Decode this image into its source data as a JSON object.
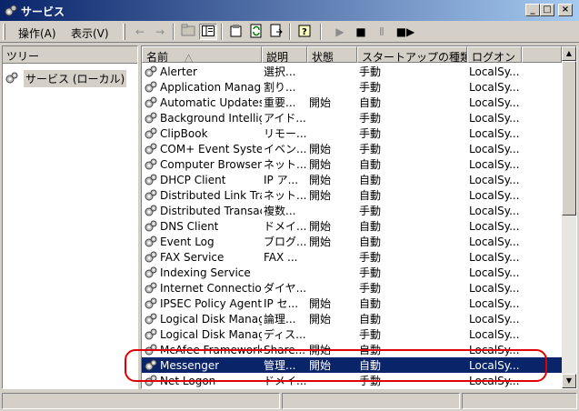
{
  "window": {
    "title": "サービス",
    "icon": "gear-icon",
    "minimize_label": "_",
    "maximize_label": "□",
    "close_label": "×"
  },
  "menu": {
    "action_label": "操作(A)",
    "view_label": "表示(V)"
  },
  "toolbar": {
    "back": "←",
    "forward": "→",
    "play": "▶",
    "stop": "■",
    "pause": "Ⅱ",
    "restart": "■▶"
  },
  "tree": {
    "header": "ツリー",
    "root_label": "サービス (ローカル)"
  },
  "list": {
    "columns": {
      "name": "名前",
      "sort_indicator": "△",
      "description": "説明",
      "status": "状態",
      "startup": "スタートアップの種類",
      "logon": "ログオン"
    },
    "rows": [
      {
        "name": "Alerter",
        "description": "選択...",
        "status": "",
        "startup": "手動",
        "logon": "LocalSy..."
      },
      {
        "name": "Application Manage...",
        "description": "割り...",
        "status": "",
        "startup": "手動",
        "logon": "LocalSy..."
      },
      {
        "name": "Automatic Updates",
        "description": "重要...",
        "status": "開始",
        "startup": "自動",
        "logon": "LocalSy..."
      },
      {
        "name": "Background Intellig...",
        "description": "アイド...",
        "status": "",
        "startup": "手動",
        "logon": "LocalSy..."
      },
      {
        "name": "ClipBook",
        "description": "リモー...",
        "status": "",
        "startup": "手動",
        "logon": "LocalSy..."
      },
      {
        "name": "COM+ Event System",
        "description": "イベン...",
        "status": "開始",
        "startup": "手動",
        "logon": "LocalSy..."
      },
      {
        "name": "Computer Browser",
        "description": "ネット...",
        "status": "開始",
        "startup": "自動",
        "logon": "LocalSy..."
      },
      {
        "name": "DHCP Client",
        "description": "IP ア...",
        "status": "開始",
        "startup": "自動",
        "logon": "LocalSy..."
      },
      {
        "name": "Distributed Link Tra...",
        "description": "ネット...",
        "status": "開始",
        "startup": "自動",
        "logon": "LocalSy..."
      },
      {
        "name": "Distributed Transac...",
        "description": "複数...",
        "status": "",
        "startup": "手動",
        "logon": "LocalSy..."
      },
      {
        "name": "DNS Client",
        "description": "ドメイ...",
        "status": "開始",
        "startup": "自動",
        "logon": "LocalSy..."
      },
      {
        "name": "Event Log",
        "description": "ブログ...",
        "status": "開始",
        "startup": "自動",
        "logon": "LocalSy..."
      },
      {
        "name": "FAX Service",
        "description": "FAX ...",
        "status": "",
        "startup": "手動",
        "logon": "LocalSy..."
      },
      {
        "name": "Indexing Service",
        "description": "",
        "status": "",
        "startup": "手動",
        "logon": "LocalSy..."
      },
      {
        "name": "Internet Connection...",
        "description": "ダイヤ...",
        "status": "",
        "startup": "手動",
        "logon": "LocalSy..."
      },
      {
        "name": "IPSEC Policy Agent",
        "description": "IP セ...",
        "status": "開始",
        "startup": "自動",
        "logon": "LocalSy..."
      },
      {
        "name": "Logical Disk Manag...",
        "description": "論理...",
        "status": "開始",
        "startup": "自動",
        "logon": "LocalSy..."
      },
      {
        "name": "Logical Disk Manag...",
        "description": "ディス...",
        "status": "",
        "startup": "手動",
        "logon": "LocalSy..."
      },
      {
        "name": "McAfee Framework...",
        "description": "Share...",
        "status": "開始",
        "startup": "自動",
        "logon": "LocalSy..."
      },
      {
        "name": "Messenger",
        "description": "管理...",
        "status": "開始",
        "startup": "自動",
        "logon": "LocalSy...",
        "selected": true
      },
      {
        "name": "Net Logon",
        "description": "ドメイ...",
        "status": "",
        "startup": "手動",
        "logon": "LocalSy..."
      }
    ]
  },
  "colors": {
    "selection": "#0a246a",
    "highlight_annotation": "#e00000",
    "chrome": "#d4d0c8"
  }
}
